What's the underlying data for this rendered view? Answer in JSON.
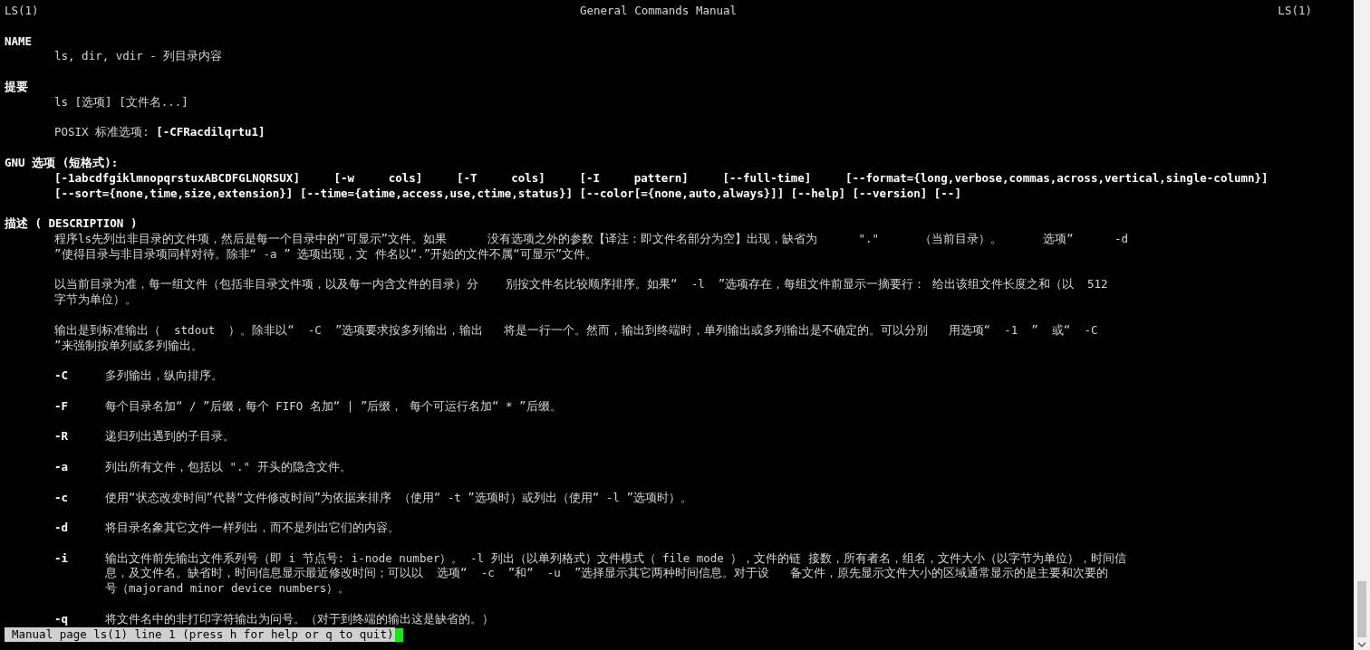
{
  "header": {
    "left": "LS(1)",
    "center": "General Commands Manual",
    "right": "LS(1)"
  },
  "sections": [
    {
      "heading": "NAME",
      "blocks": [
        {
          "kind": "text",
          "lines": [
            "ls, dir, vdir - 列目录内容"
          ]
        }
      ]
    },
    {
      "heading": "提要",
      "blocks": [
        {
          "kind": "text",
          "lines": [
            "ls [选项] [文件名...]"
          ]
        },
        {
          "kind": "text",
          "lines": [
            "POSIX 标准选项: **[-CFRacdilqrtu1]**"
          ]
        }
      ]
    },
    {
      "heading": "GNU 选项 (短格式):",
      "blocks": [
        {
          "kind": "code",
          "lines": [
            "[-1abcdfgiklmnopqrstuxABCDFGLNQRSUX]     [-w     cols]     [-T     cols]     [-I     pattern]     [--full-time]     [--format={long,verbose,commas,across,vertical,single-column}]",
            "[--sort={none,time,size,extension}] [--time={atime,access,use,ctime,status}] [--color[={none,auto,always}]] [--help] [--version] [--]"
          ]
        }
      ]
    },
    {
      "heading": "描述 ( DESCRIPTION )",
      "blocks": [
        {
          "kind": "text",
          "lines": [
            "程序ls先列出非目录的文件项，然后是每一个目录中的“可显示”文件。如果      没有选项之外的参数【译注：即文件名部分为空】出现，缺省为      \".\"      （当前目录）。      选项“      -d",
            "”使得目录与非目录项同样对待。除非“ -a ” 选项出现，文 件名以“.”开始的文件不属“可显示”文件。"
          ]
        },
        {
          "kind": "text",
          "lines": [
            "以当前目录为准，每一组文件（包括非目录文件项，以及每一内含文件的目录）分    别按文件名比较顺序排序。如果“  -l  ”选项存在，每组文件前显示一摘要行： 给出该组文件长度之和（以  512",
            "字节为单位）。"
          ]
        },
        {
          "kind": "text",
          "lines": [
            "输出是到标准输出（  stdout  ）。除非以“  -C  ”选项要求按多列输出，输出   将是一行一个。然而，输出到终端时，单列输出或多列输出是不确定的。可以分别   用选项“  -1  ”  或“  -C",
            "”来强制按单列或多列输出。"
          ]
        },
        {
          "kind": "option",
          "flag": "-C",
          "lines": [
            "多列输出，纵向排序。"
          ]
        },
        {
          "kind": "option",
          "flag": "-F",
          "lines": [
            "每个目录名加“ / ”后缀，每个 FIFO 名加“ | ”后缀， 每个可运行名加“ * ”后缀。"
          ]
        },
        {
          "kind": "option",
          "flag": "-R",
          "lines": [
            "递归列出遇到的子目录。"
          ]
        },
        {
          "kind": "option",
          "flag": "-a",
          "lines": [
            "列出所有文件，包括以 \".\" 开头的隐含文件。"
          ]
        },
        {
          "kind": "option",
          "flag": "-c",
          "lines": [
            "使用“状态改变时间”代替“文件修改时间”为依据来排序 （使用“ -t ”选项时）或列出（使用“ -l ”选项时）。"
          ]
        },
        {
          "kind": "option",
          "flag": "-d",
          "lines": [
            "将目录名象其它文件一样列出，而不是列出它们的内容。"
          ]
        },
        {
          "kind": "option",
          "flag": "-i",
          "lines": [
            "输出文件前先输出文件系列号（即 i 节点号: i-node number）。 -l 列出（以单列格式）文件模式（ file mode ），文件的链 接数，所有者名，组名，文件大小（以字节为单位），时间信",
            "息，及文件名。缺省时，时间信息显示最近修改时间；可以以  选项“  -c  ”和“  -u  ”选择显示其它两种时间信息。对于设   备文件，原先显示文件大小的区域通常显示的是主要和次要的",
            "号（majorand minor device numbers）。"
          ]
        },
        {
          "kind": "option",
          "flag": "-q",
          "lines": [
            "将文件名中的非打印字符输出为问号。（对于到终端的输出这是缺省的。）"
          ]
        }
      ]
    }
  ],
  "status_line": "Manual page ls(1) line 1 (press h for help or q to quit)"
}
